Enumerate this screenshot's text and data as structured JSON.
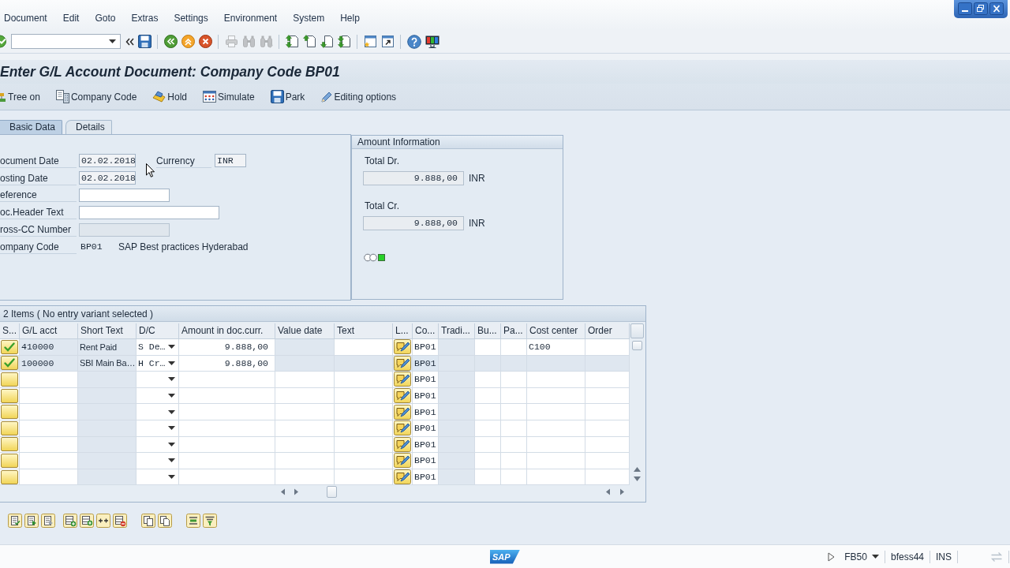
{
  "menu_bar": [
    "Document",
    "Edit",
    "Goto",
    "Extras",
    "Settings",
    "Environment",
    "System",
    "Help"
  ],
  "standard_toolbar": [
    [
      {
        "kind": "enter",
        "disabled": false
      },
      {
        "kind": "collapse",
        "disabled": false
      },
      {
        "kind": "save",
        "disabled": false
      }
    ],
    [
      {
        "kind": "back",
        "disabled": false
      },
      {
        "kind": "exit",
        "disabled": false
      },
      {
        "kind": "cancel",
        "disabled": false
      }
    ],
    [
      {
        "kind": "print",
        "disabled": true
      },
      {
        "kind": "find",
        "disabled": true
      },
      {
        "kind": "find_next",
        "disabled": true
      }
    ],
    [
      {
        "kind": "first_page",
        "disabled": false
      },
      {
        "kind": "previous_page",
        "disabled": false
      },
      {
        "kind": "next_page",
        "disabled": false
      },
      {
        "kind": "last_page",
        "disabled": false
      }
    ],
    [
      {
        "kind": "new_session",
        "disabled": false
      },
      {
        "kind": "shortcut",
        "disabled": false
      }
    ],
    [
      {
        "kind": "help",
        "disabled": false
      },
      {
        "kind": "layout",
        "disabled": false
      }
    ]
  ],
  "title": "Enter G/L Account Document: Company Code BP01",
  "application_toolbar": [
    {
      "kind": "tree",
      "label": "Tree on"
    },
    {
      "kind": "company_code",
      "label": "Company Code"
    },
    {
      "kind": "hold",
      "label": "Hold"
    },
    {
      "kind": "simulate",
      "label": "Simulate"
    },
    {
      "kind": "park",
      "label": "Park"
    },
    {
      "kind": "editing_options",
      "label": "Editing options"
    }
  ],
  "tabs": [
    {
      "label": "Basic Data",
      "selected": true
    },
    {
      "label": "Details",
      "selected": false
    }
  ],
  "basic_data": {
    "document_date": {
      "label": "ocument Date",
      "value": "02.02.2018",
      "disabled": false
    },
    "currency": {
      "label": "Currency",
      "value": "INR",
      "disabled": false
    },
    "posting_date": {
      "label": "osting Date",
      "value": "02.02.2018",
      "disabled": false
    },
    "reference": {
      "label": "eference",
      "disabled": false
    },
    "doc_header_text": {
      "label": "oc.Header Text",
      "disabled": false
    },
    "cross_cc_number": {
      "label": "ross-CC Number",
      "disabled": true
    },
    "company_code": {
      "label": "ompany Code",
      "value": "BP01",
      "name": "SAP Best practices Hyderabad"
    }
  },
  "amount_information": {
    "title": "Amount Information",
    "totals": [
      {
        "label": "Total Dr.",
        "value": "9.888,00",
        "currency": "INR"
      },
      {
        "label": "Total Cr.",
        "value": "9.888,00",
        "currency": "INR"
      }
    ],
    "traffic_light": {
      "red": false,
      "yellow": false,
      "green": true
    }
  },
  "items_table": {
    "title": "2 Items ( No entry variant selected )",
    "columns": [
      "S...",
      "G/L acct",
      "Short Text",
      "D/C",
      "Amount in doc.curr.",
      "Value date",
      "Text",
      "L...",
      "Co...",
      "Tradi...",
      "Bu...",
      "Pa...",
      "Cost center",
      "Order"
    ],
    "rows": [
      {
        "checked": true,
        "selected": false,
        "gl_acct": "410000",
        "short_text": "Rent Paid",
        "dc": "S De…",
        "amount": "9.888,00",
        "column_9": "BP01",
        "cost_center": "C100"
      },
      {
        "checked": true,
        "selected": true,
        "gl_acct": "100000",
        "short_text": "SBI Main Ba…",
        "dc": "H Cr…",
        "amount": "9.888,00",
        "column_9": "BP01"
      },
      {
        "checked": false,
        "selected": false,
        "column_9": "BP01"
      },
      {
        "checked": false,
        "selected": false,
        "column_9": "BP01"
      },
      {
        "checked": false,
        "selected": false,
        "column_9": "BP01"
      },
      {
        "checked": false,
        "selected": false,
        "column_9": "BP01"
      },
      {
        "checked": false,
        "selected": false,
        "column_9": "BP01"
      },
      {
        "checked": false,
        "selected": false,
        "column_9": "BP01"
      },
      {
        "checked": false,
        "selected": false,
        "column_9": "BP01"
      }
    ]
  },
  "status_bar": {
    "logo": "SAP",
    "transaction": "FB50",
    "user": "bfess44",
    "mode": "INS"
  }
}
